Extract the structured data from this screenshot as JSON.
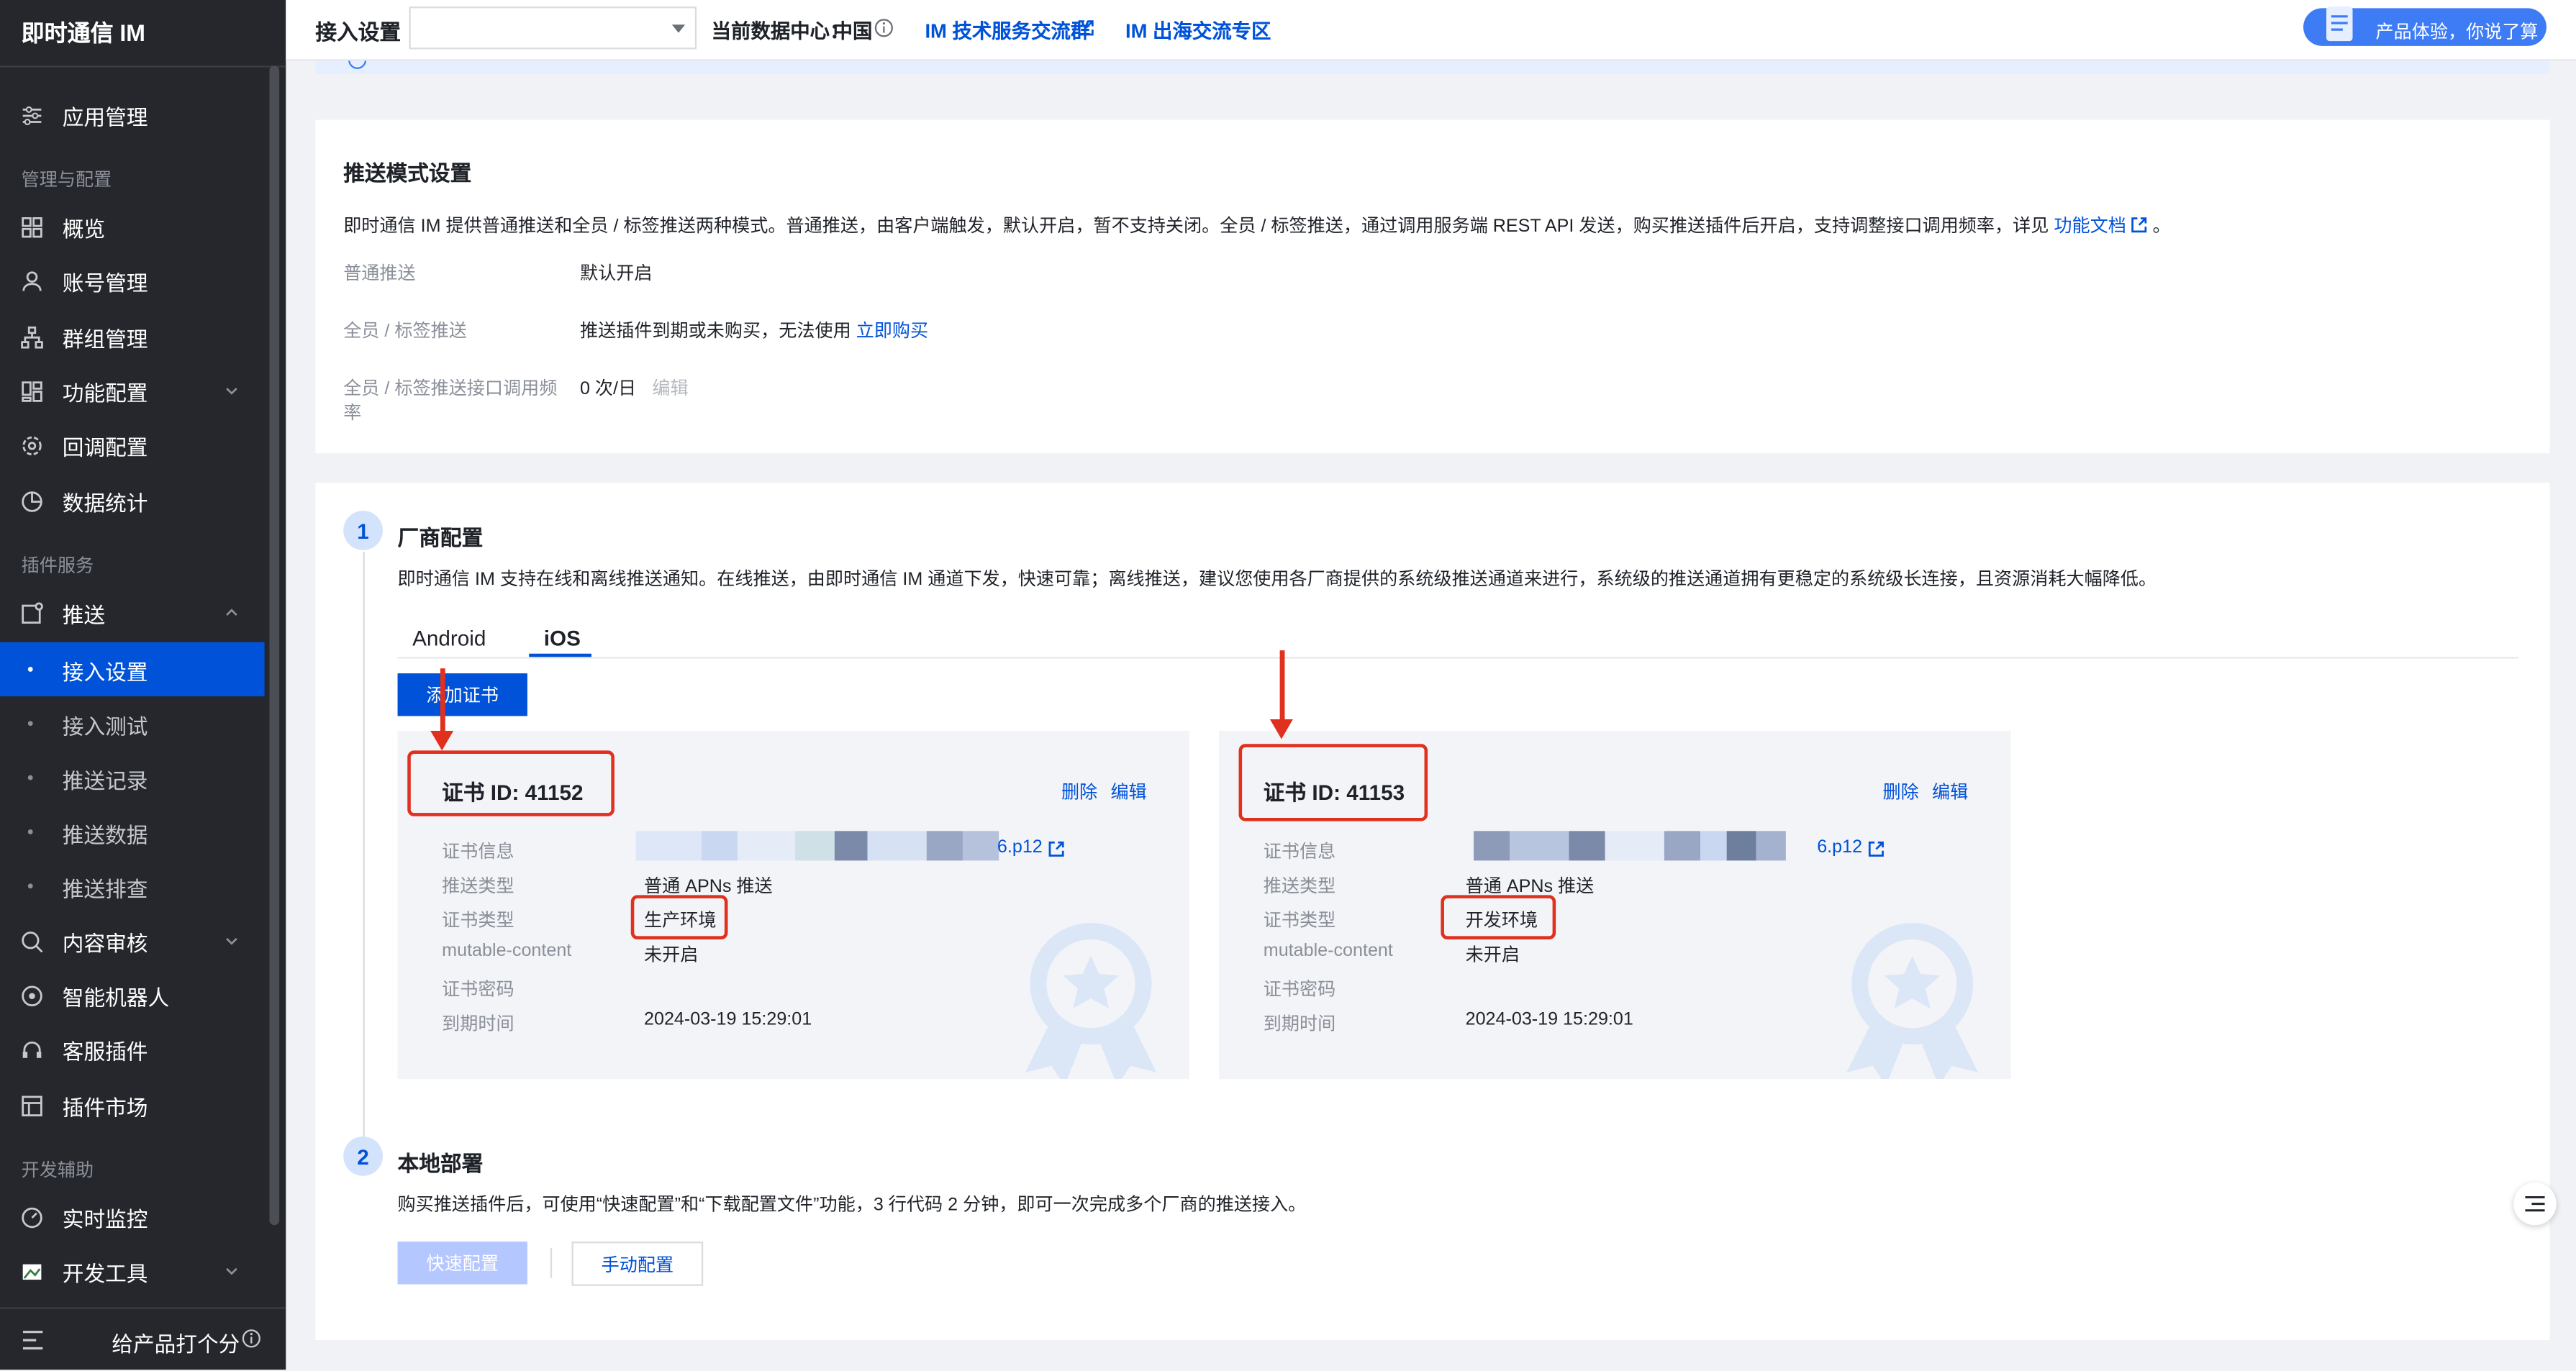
{
  "app": {
    "title": "即时通信 IM"
  },
  "sidebar": {
    "app_manage": "应用管理",
    "group_manage_config": "管理与配置",
    "overview": "概览",
    "account": "账号管理",
    "group": "群组管理",
    "feature": "功能配置",
    "callback": "回调配置",
    "stats": "数据统计",
    "group_plugin": "插件服务",
    "push": "推送",
    "push_sub": [
      "接入设置",
      "接入测试",
      "推送记录",
      "推送数据",
      "推送排查"
    ],
    "content_audit": "内容审核",
    "ai_robot": "智能机器人",
    "customer_service": "客服插件",
    "plugin_market": "插件市场",
    "group_dev": "开发辅助",
    "monitor": "实时监控",
    "dev_tools": "开发工具",
    "footer_rate": "给产品打个分"
  },
  "topbar": {
    "page_title": "接入设置",
    "datacenter_label": "当前数据中心：",
    "datacenter_value": "中国",
    "link_tech": "IM 技术服务交流群",
    "link_overseas": "IM 出海交流专区",
    "feedback": "产品体验，你说了算"
  },
  "push_mode": {
    "title": "推送模式设置",
    "desc_prefix": "即时通信 IM 提供普通推送和全员 / 标签推送两种模式。普通推送，由客户端触发，默认开启，暂不支持关闭。全员 / 标签推送，通过调用服务端 REST API 发送，购买推送插件后开启，支持调整接口调用频率，详见",
    "desc_link": "功能文档",
    "desc_suffix": "。",
    "rows": [
      {
        "label": "普通推送",
        "value": "默认开启"
      },
      {
        "label": "全员 / 标签推送",
        "value": "推送插件到期或未购买，无法使用",
        "link": "立即购买"
      },
      {
        "label_line1": "全员 / 标签推送接口调用频",
        "label_line2": "率",
        "value": "0 次/日",
        "action": "编辑"
      }
    ]
  },
  "vendor": {
    "step": "1",
    "title": "厂商配置",
    "desc": "即时通信 IM 支持在线和离线推送通知。在线推送，由即时通信 IM 通道下发，快速可靠；离线推送，建议您使用各厂商提供的系统级推送通道来进行，系统级的推送通道拥有更稳定的系统级长连接，且资源消耗大幅降低。",
    "tabs": [
      "Android",
      "iOS"
    ],
    "active_tab": "iOS",
    "add_cert": "添加证书",
    "certs": [
      {
        "id_label": "证书 ID: 41152",
        "delete": "删除",
        "edit": "编辑",
        "rows": [
          {
            "label": "证书信息",
            "value": "6.p12"
          },
          {
            "label": "推送类型",
            "value": "普通 APNs 推送"
          },
          {
            "label": "证书类型",
            "value": "生产环境"
          },
          {
            "label": "mutable-content",
            "value": "未开启"
          },
          {
            "label": "证书密码",
            "value": ""
          },
          {
            "label": "到期时间",
            "value": "2024-03-19 15:29:01"
          }
        ]
      },
      {
        "id_label": "证书 ID: 41153",
        "delete": "删除",
        "edit": "编辑",
        "rows": [
          {
            "label": "证书信息",
            "value": "6.p12"
          },
          {
            "label": "推送类型",
            "value": "普通 APNs 推送"
          },
          {
            "label": "证书类型",
            "value": "开发环境"
          },
          {
            "label": "mutable-content",
            "value": "未开启"
          },
          {
            "label": "证书密码",
            "value": ""
          },
          {
            "label": "到期时间",
            "value": "2024-03-19 15:29:01"
          }
        ]
      }
    ]
  },
  "local_deploy": {
    "step": "2",
    "title": "本地部署",
    "desc": "购买推送插件后，可使用“快速配置”和“下载配置文件”功能，3 行代码 2 分钟，即可一次完成多个厂商的推送接入。",
    "quick_btn": "快速配置",
    "manual_btn": "手动配置"
  },
  "colors": {
    "accent": "#0052d9",
    "sidebar_bg": "#25272c",
    "annotation_red": "#e0301e"
  }
}
